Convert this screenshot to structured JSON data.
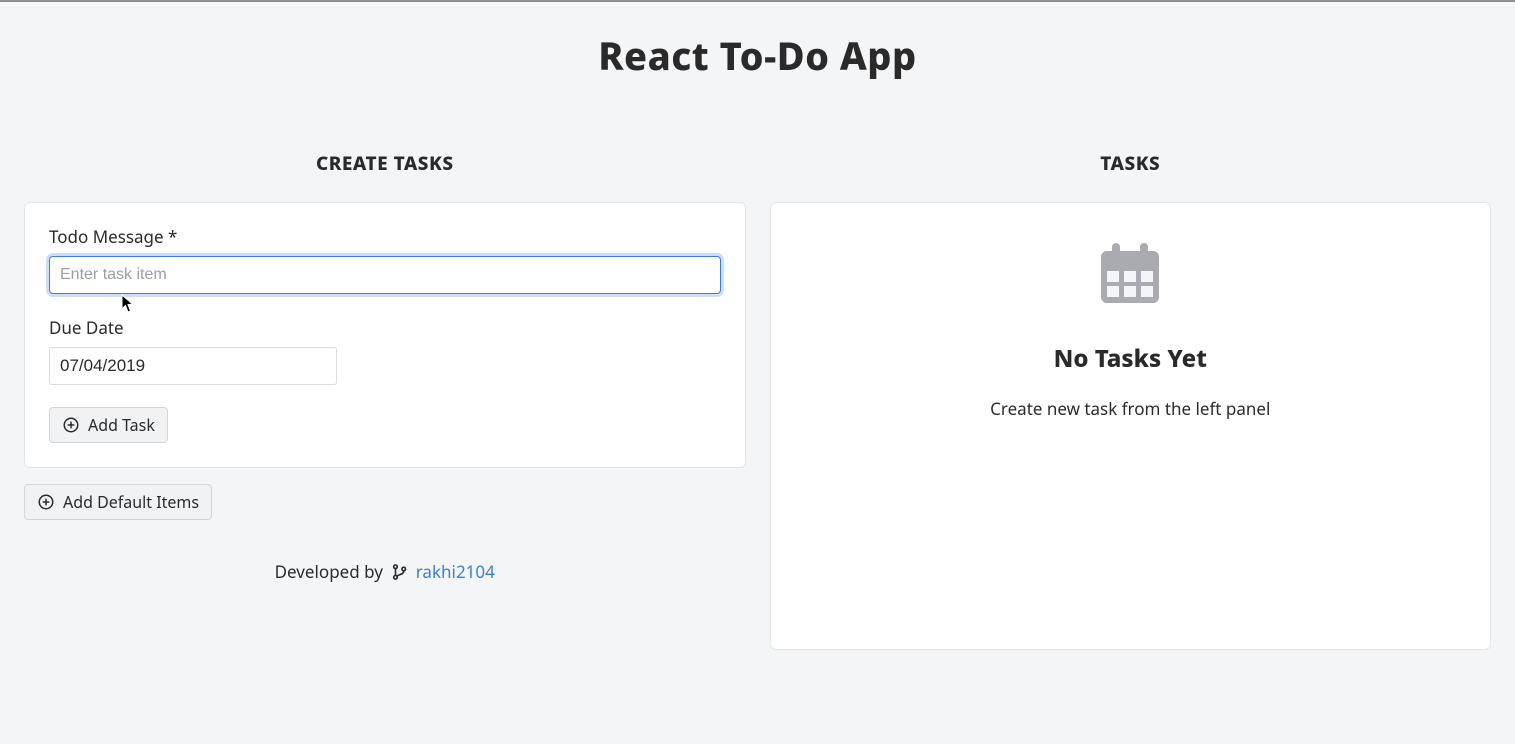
{
  "header": {
    "title": "React To-Do App"
  },
  "left": {
    "title": "CREATE TASKS",
    "form": {
      "message_label": "Todo Message *",
      "message_placeholder": "Enter task item",
      "message_value": "",
      "date_label": "Due Date",
      "date_value": "07/04/2019",
      "add_task_label": "Add Task"
    },
    "add_default_label": "Add Default Items",
    "credit_prefix": "Developed by ",
    "credit_user": "rakhi2104"
  },
  "right": {
    "title": "TASKS",
    "empty_title": "No Tasks Yet",
    "empty_sub": "Create new task from the left panel"
  }
}
